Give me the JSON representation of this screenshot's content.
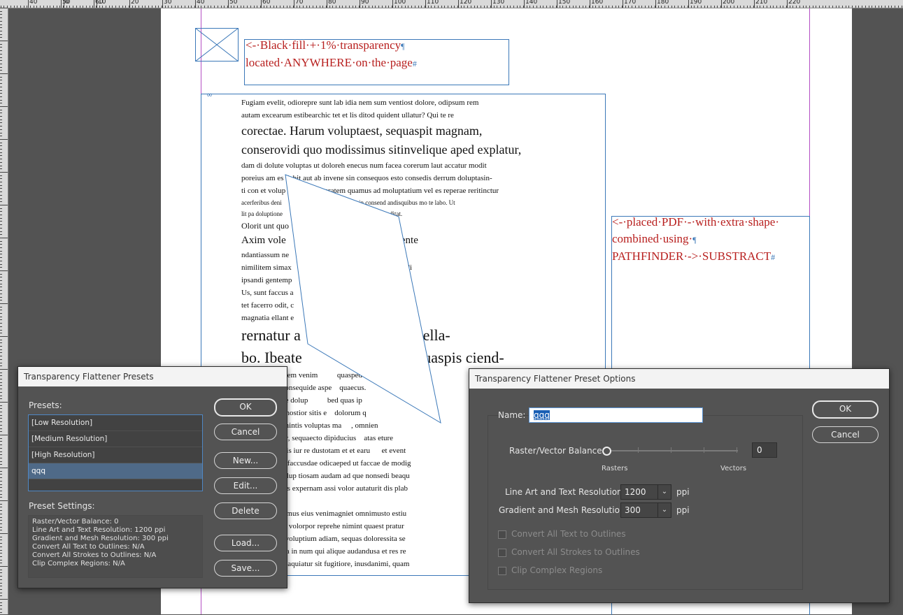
{
  "ruler": {
    "labels": [
      "40",
      "50",
      "60",
      "0",
      "10",
      "20",
      "30",
      "40",
      "50",
      "60",
      "70",
      "80",
      "90",
      "100",
      "110",
      "120",
      "130",
      "140",
      "150",
      "160",
      "170",
      "180",
      "190",
      "200",
      "210",
      "220"
    ]
  },
  "canvas": {
    "note1": "<-·Black·fill·+·1%·transparency",
    "note1b": "located·ANYWHERE·on·the·page",
    "note2a": "<-·placed·PDF·-·with·extra·shape·",
    "note2b": "combined·using·",
    "note2c": "PATHFINDER·->·SUBSTRACT",
    "pilcrow": "¶",
    "hash": "#",
    "body": [
      {
        "size": 11,
        "text": "Fugiam evelit, odiorepre sunt lab idia nem sum ventiost dolore, odipsum rem"
      },
      {
        "size": 11,
        "text": "autam excearum estibearchic tet et lis ditod quident ullatur? Qui te re"
      },
      {
        "size": 18,
        "text": "corectae. Harum voluptaest, sequaspit magnam,"
      },
      {
        "size": 18,
        "text": "conserovidi quo modissimus sitinvelique aped explatur, ut alibus-"
      },
      {
        "size": 11,
        "text": "dam di dolute voluptas ut doloreh enecus num facea corerum laut accatur modit"
      },
      {
        "size": 11,
        "text": "poreius am es debit aut ab invene sin consequos esto consedis derrum doluptasin-"
      },
      {
        "size": 11,
        "text": "ti con et volup   nam anis peratem quamus ad moluptatium vel es reperae reritinctur"
      },
      {
        "size": 9,
        "text": "acerferibus deni      perro qui ipicia qui nulpa sin consend andisquibus mo te labo. Ut"
      },
      {
        "size": 9,
        "text": "lit pa doluptione        ve verchic tem que etur aperist, et landitat."
      },
      {
        "size": 12,
        "text": "Olorit unt quo                vid elicid quatiunt."
      },
      {
        "size": 15,
        "text": "Axim vole                ? Alictustrum volente"
      },
      {
        "size": 11,
        "text": "ndantiassum ne              aquis debit quo omnihicium"
      },
      {
        "size": 11,
        "text": "nimilitem simax               necta qui beratiunt aut et undi"
      },
      {
        "size": 11,
        "text": "ipsandi gentemp"
      },
      {
        "size": 11,
        "text": "Us, sunt faccus a              uaio idem vid quosam sam,"
      },
      {
        "size": 11,
        "text": "tet facerro odit, c              litatur, sed quidem. Nobis"
      },
      {
        "size": 11,
        "text": "magnatia ellant e               aute si blabo. Itas"
      },
      {
        "size": 22,
        "text": "rernatur a                  as as invella-"
      },
      {
        "size": 22,
        "text": "bo. Ibeate                piti ium quaspis ciend-"
      },
      {
        "size": 11,
        "text": "icidem fuga. Nem venim          quasped quia prorem repro"
      },
      {
        "size": 11,
        "text": "eossimpe ne nonsequide aspe    quaecus."
      },
      {
        "size": 11,
        "text": "st, omnima que dolup          bed quas ip"
      },
      {
        "size": 11,
        "text": "ga. Nam eliae nostior sitis e    dolorum q"
      },
      {
        "size": 11,
        "text": "voloriasimus mintis voluptas ma     , omnien"
      },
      {
        "size": 11,
        "text": "m dolent utatur, sequaecto dipiducius    atas eture"
      },
      {
        "size": 11,
        "text": "gnam recepercis iur re dustotam et et earu      et event"
      },
      {
        "size": 11,
        "text": "odisin ctiati ut faccusdae odicaeped ut faccae de modig"
      },
      {
        "size": 11,
        "text": "s volupta temolup tiosam audam ad que nonsedi beaqu"
      },
      {
        "size": 11,
        "text": "reper ferumquis expernam assi volor autaturit dis plab"
      },
      {
        "size": 11,
        "text": ""
      },
      {
        "size": 11,
        "text": "daecte reniassimus eius venimagniet omnimusto estiu"
      },
      {
        "size": 11,
        "text": "bo. Nam quam volorpor reprehe nimint quaest pratur"
      },
      {
        "size": 11,
        "text": "tat alitat delia voluptium adiam, sequas doloressita se"
      },
      {
        "size": 11,
        "text": "sitatem quibusa in num qui alique audandusa et res re"
      },
      {
        "size": 11,
        "text": "tempor as si beaquiatur sit fugitiore, inusdanimi, quam"
      }
    ]
  },
  "presets_dialog": {
    "title": "Transparency Flattener Presets",
    "presets_label": "Presets:",
    "presets": [
      "[Low Resolution]",
      "[Medium Resolution]",
      "[High Resolution]",
      "qqq"
    ],
    "selected": "qqq",
    "settings_label": "Preset Settings:",
    "settings": [
      "Raster/Vector Balance: 0",
      "Line Art and Text Resolution: 1200 ppi",
      "Gradient and Mesh Resolution: 300 ppi",
      "Convert All Text to Outlines: N/A",
      "Convert All Strokes to Outlines: N/A",
      "Clip Complex Regions: N/A"
    ],
    "buttons": {
      "ok": "OK",
      "cancel": "Cancel",
      "new": "New...",
      "edit": "Edit...",
      "delete": "Delete",
      "load": "Load...",
      "save": "Save..."
    }
  },
  "options_dialog": {
    "title": "Transparency Flattener Preset Options",
    "name_label": "Name:",
    "name_value": "qqq",
    "balance_label": "Raster/Vector Balance:",
    "balance_value": "0",
    "rasters_label": "Rasters",
    "vectors_label": "Vectors",
    "line_art_label": "Line Art and Text Resolution:",
    "line_art_value": "1200",
    "gradient_label": "Gradient and Mesh Resolution:",
    "gradient_value": "300",
    "ppi": "ppi",
    "convert_text": "Convert All Text to Outlines",
    "convert_strokes": "Convert All Strokes to Outlines",
    "clip_regions": "Clip Complex Regions",
    "ok": "OK",
    "cancel": "Cancel"
  }
}
